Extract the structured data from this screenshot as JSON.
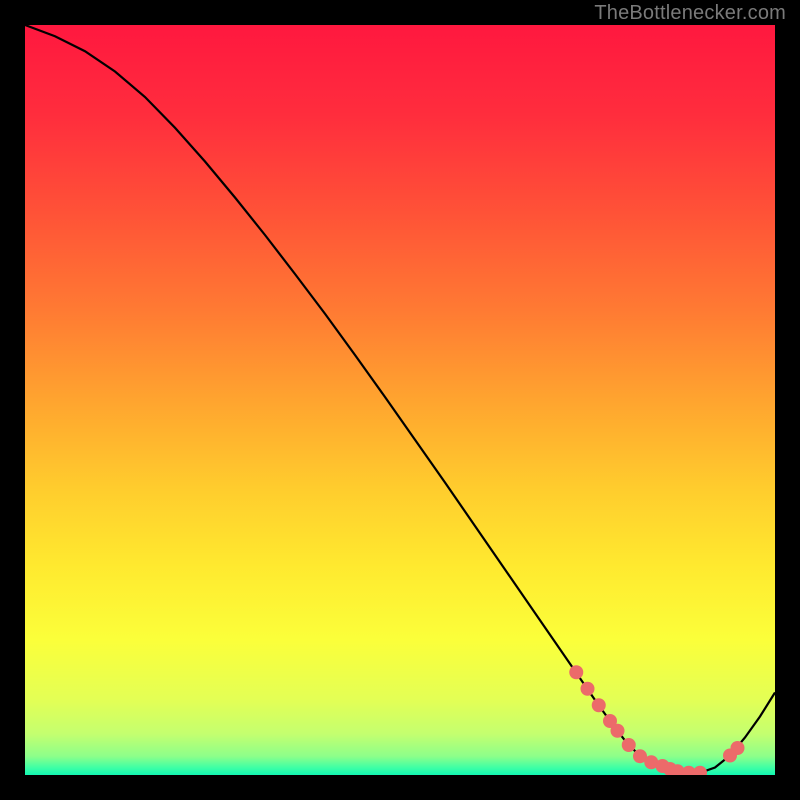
{
  "attribution": "TheBottlenecker.com",
  "chart_data": {
    "type": "line",
    "title": "",
    "xlabel": "",
    "ylabel": "",
    "xlim": [
      0,
      100
    ],
    "ylim": [
      0,
      100
    ],
    "grid": false,
    "series": [
      {
        "name": "curve",
        "x": [
          0,
          4,
          8,
          12,
          16,
          20,
          24,
          28,
          32,
          36,
          40,
          44,
          48,
          52,
          56,
          60,
          64,
          68,
          72,
          74,
          76,
          78,
          80,
          82,
          84,
          86,
          88,
          90,
          92,
          94,
          96,
          98,
          100
        ],
        "y": [
          100,
          98.5,
          96.5,
          93.8,
          90.4,
          86.3,
          81.8,
          77.0,
          72.0,
          66.8,
          61.5,
          56.0,
          50.4,
          44.7,
          39.0,
          33.2,
          27.4,
          21.6,
          15.8,
          12.9,
          10.0,
          7.2,
          4.6,
          2.5,
          1.2,
          0.5,
          0.2,
          0.3,
          1.0,
          2.6,
          5.0,
          7.8,
          11.0
        ]
      }
    ],
    "markers": {
      "name": "dots",
      "x": [
        73.5,
        75.0,
        76.5,
        78.0,
        79.0,
        80.5,
        82.0,
        83.5,
        85.0,
        86.0,
        87.0,
        88.5,
        90.0,
        94.0,
        95.0
      ],
      "y": [
        13.7,
        11.5,
        9.3,
        7.2,
        5.9,
        4.0,
        2.5,
        1.7,
        1.2,
        0.8,
        0.5,
        0.3,
        0.3,
        2.6,
        3.6
      ]
    },
    "gradient_stops": [
      {
        "offset": 0.0,
        "color": "#ff183f"
      },
      {
        "offset": 0.12,
        "color": "#ff2d3d"
      },
      {
        "offset": 0.25,
        "color": "#ff5237"
      },
      {
        "offset": 0.38,
        "color": "#ff7a33"
      },
      {
        "offset": 0.5,
        "color": "#ffa42f"
      },
      {
        "offset": 0.62,
        "color": "#ffcd2d"
      },
      {
        "offset": 0.72,
        "color": "#ffe92f"
      },
      {
        "offset": 0.82,
        "color": "#fbff3a"
      },
      {
        "offset": 0.9,
        "color": "#e3ff55"
      },
      {
        "offset": 0.945,
        "color": "#c4ff6f"
      },
      {
        "offset": 0.975,
        "color": "#8dff8a"
      },
      {
        "offset": 0.99,
        "color": "#3fffa5"
      },
      {
        "offset": 1.0,
        "color": "#12f7b2"
      }
    ],
    "marker_color": "#ec6a6a",
    "curve_color": "#000000"
  }
}
